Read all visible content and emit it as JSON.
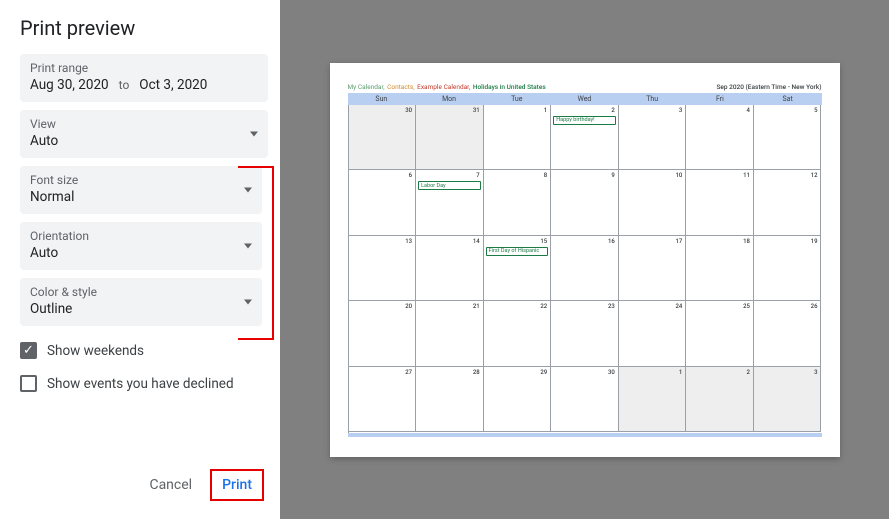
{
  "title": "Print preview",
  "range": {
    "label": "Print range",
    "start": "Aug 30, 2020",
    "to": "to",
    "end": "Oct 3, 2020"
  },
  "view": {
    "label": "View",
    "value": "Auto"
  },
  "fontsize": {
    "label": "Font size",
    "value": "Normal"
  },
  "orientation": {
    "label": "Orientation",
    "value": "Auto"
  },
  "colorstyle": {
    "label": "Color & style",
    "value": "Outline"
  },
  "show_weekends": {
    "label": "Show weekends",
    "checked": true
  },
  "show_declined": {
    "label": "Show events you have declined",
    "checked": false
  },
  "footer": {
    "cancel": "Cancel",
    "print": "Print"
  },
  "preview": {
    "calendars": [
      {
        "name": "My Calendar",
        "cls": "cal-my"
      },
      {
        "name": "Contacts",
        "cls": "cal-con"
      },
      {
        "name": "Example Calendar",
        "cls": "cal-ex"
      },
      {
        "name": "Holidays in United States",
        "cls": "cal-hol"
      }
    ],
    "tz": "Sep 2020 (Eastern Time - New York)",
    "dow": [
      "Sun",
      "Mon",
      "Tue",
      "Wed",
      "Thu",
      "Fri",
      "Sat"
    ],
    "weeks": [
      [
        {
          "n": "30",
          "dim": true
        },
        {
          "n": "31",
          "dim": true
        },
        {
          "n": "1"
        },
        {
          "n": "2",
          "ev": "Happy birthday!"
        },
        {
          "n": "3"
        },
        {
          "n": "4"
        },
        {
          "n": "5"
        }
      ],
      [
        {
          "n": "6"
        },
        {
          "n": "7",
          "ev": "Labor Day"
        },
        {
          "n": "8"
        },
        {
          "n": "9"
        },
        {
          "n": "10"
        },
        {
          "n": "11"
        },
        {
          "n": "12"
        }
      ],
      [
        {
          "n": "13"
        },
        {
          "n": "14"
        },
        {
          "n": "15",
          "ev": "First Day of Hispanic"
        },
        {
          "n": "16"
        },
        {
          "n": "17"
        },
        {
          "n": "18"
        },
        {
          "n": "19"
        }
      ],
      [
        {
          "n": "20"
        },
        {
          "n": "21"
        },
        {
          "n": "22"
        },
        {
          "n": "23"
        },
        {
          "n": "24"
        },
        {
          "n": "25"
        },
        {
          "n": "26"
        }
      ],
      [
        {
          "n": "27"
        },
        {
          "n": "28"
        },
        {
          "n": "29"
        },
        {
          "n": "30"
        },
        {
          "n": "1",
          "dim": true
        },
        {
          "n": "2",
          "dim": true
        },
        {
          "n": "3",
          "dim": true
        }
      ]
    ]
  }
}
